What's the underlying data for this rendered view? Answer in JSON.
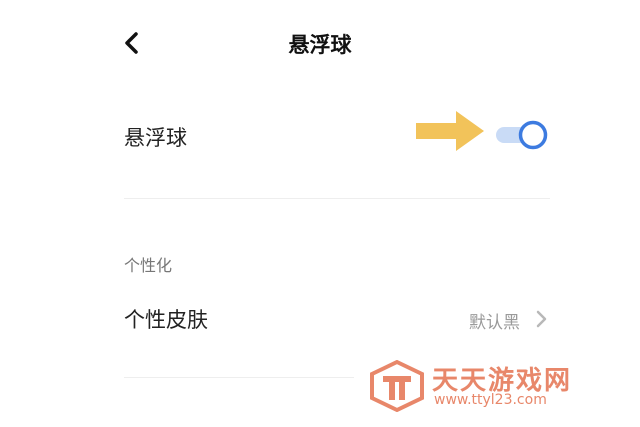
{
  "header": {
    "title": "悬浮球"
  },
  "floating_ball": {
    "label": "悬浮球",
    "enabled": true
  },
  "personalization": {
    "section_title": "个性化",
    "skin_label": "个性皮肤",
    "skin_value": "默认黑"
  },
  "watermark": {
    "name": "天天游戏网",
    "url": "www.ttyl23.com"
  },
  "colors": {
    "toggle_track": "#c9dbf6",
    "toggle_knob_border": "#3d7be0",
    "arrow": "#f2c35a",
    "watermark": "#e8876a"
  }
}
